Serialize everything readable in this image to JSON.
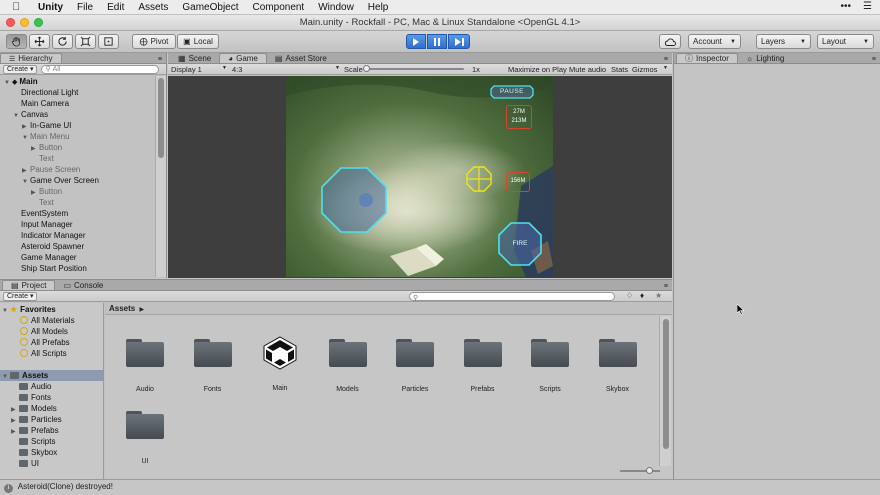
{
  "menubar": {
    "app": "Unity",
    "items": [
      "File",
      "Edit",
      "Assets",
      "GameObject",
      "Component",
      "Window",
      "Help"
    ]
  },
  "window": {
    "title": "Main.unity - Rockfall - PC, Mac & Linux Standalone <OpenGL 4.1>"
  },
  "toolbar": {
    "pivot": "Pivot",
    "local": "Local",
    "account": "Account",
    "layers": "Layers",
    "layout": "Layout"
  },
  "hierarchy": {
    "tab": "Hierarchy",
    "create": "Create",
    "search_placeholder": "All",
    "rows": [
      {
        "label": "Main",
        "depth": 0,
        "expand": "open",
        "bold": true,
        "dim": false
      },
      {
        "label": "Directional Light",
        "depth": 1,
        "expand": "",
        "bold": false,
        "dim": false
      },
      {
        "label": "Main Camera",
        "depth": 1,
        "expand": "",
        "bold": false,
        "dim": false
      },
      {
        "label": "Canvas",
        "depth": 1,
        "expand": "open",
        "bold": false,
        "dim": false
      },
      {
        "label": "In-Game UI",
        "depth": 2,
        "expand": "closed",
        "bold": false,
        "dim": false
      },
      {
        "label": "Main Menu",
        "depth": 2,
        "expand": "open",
        "bold": false,
        "dim": true
      },
      {
        "label": "Button",
        "depth": 3,
        "expand": "closed",
        "bold": false,
        "dim": true
      },
      {
        "label": "Text",
        "depth": 3,
        "expand": "",
        "bold": false,
        "dim": true
      },
      {
        "label": "Pause Screen",
        "depth": 2,
        "expand": "closed",
        "bold": false,
        "dim": true
      },
      {
        "label": "Game Over Screen",
        "depth": 2,
        "expand": "open",
        "bold": false,
        "dim": false
      },
      {
        "label": "Button",
        "depth": 3,
        "expand": "closed",
        "bold": false,
        "dim": true
      },
      {
        "label": "Text",
        "depth": 3,
        "expand": "",
        "bold": false,
        "dim": true
      },
      {
        "label": "EventSystem",
        "depth": 1,
        "expand": "",
        "bold": false,
        "dim": false
      },
      {
        "label": "Input Manager",
        "depth": 1,
        "expand": "",
        "bold": false,
        "dim": false
      },
      {
        "label": "Indicator Manager",
        "depth": 1,
        "expand": "",
        "bold": false,
        "dim": false
      },
      {
        "label": "Asteroid Spawner",
        "depth": 1,
        "expand": "",
        "bold": false,
        "dim": false
      },
      {
        "label": "Game Manager",
        "depth": 1,
        "expand": "",
        "bold": false,
        "dim": false
      },
      {
        "label": "Ship Start Position",
        "depth": 1,
        "expand": "",
        "bold": false,
        "dim": false
      }
    ]
  },
  "game": {
    "tabs": [
      "Scene",
      "Game",
      "Asset Store"
    ],
    "active_tab": "Game",
    "display": "Display 1",
    "aspect": "4:3",
    "scale_label": "Scale",
    "scale_value": "1x",
    "options": [
      "Maximize on Play",
      "Mute audio",
      "Stats",
      "Gizmos"
    ],
    "hud": {
      "pause": "PAUSE",
      "distance_a": "27M",
      "distance_b": "213M",
      "distance_c": "156M",
      "fire": "FIRE"
    }
  },
  "inspector": {
    "tabs": [
      "Inspector",
      "Lighting"
    ]
  },
  "project": {
    "tabs": [
      "Project",
      "Console"
    ],
    "create": "Create",
    "favorites_label": "Favorites",
    "favorites": [
      "All Materials",
      "All Models",
      "All Prefabs",
      "All Scripts"
    ],
    "assets_label": "Assets",
    "tree": [
      "Audio",
      "Fonts",
      "Models",
      "Particles",
      "Prefabs",
      "Scripts",
      "Skybox",
      "UI"
    ],
    "breadcrumb": "Assets",
    "items": [
      {
        "name": "Audio",
        "kind": "folder"
      },
      {
        "name": "Fonts",
        "kind": "folder"
      },
      {
        "name": "Main",
        "kind": "unity-scene"
      },
      {
        "name": "Models",
        "kind": "folder"
      },
      {
        "name": "Particles",
        "kind": "folder"
      },
      {
        "name": "Prefabs",
        "kind": "folder"
      },
      {
        "name": "Scripts",
        "kind": "folder"
      },
      {
        "name": "Skybox",
        "kind": "folder"
      },
      {
        "name": "UI",
        "kind": "folder"
      }
    ]
  },
  "status": {
    "message": "Asteroid(Clone) destroyed!"
  },
  "colors": {
    "hud_cyan": "#4fe0ee",
    "hud_red": "#d8452e",
    "hud_yellow": "#f3e21a",
    "selection": "#3e7fe0"
  }
}
